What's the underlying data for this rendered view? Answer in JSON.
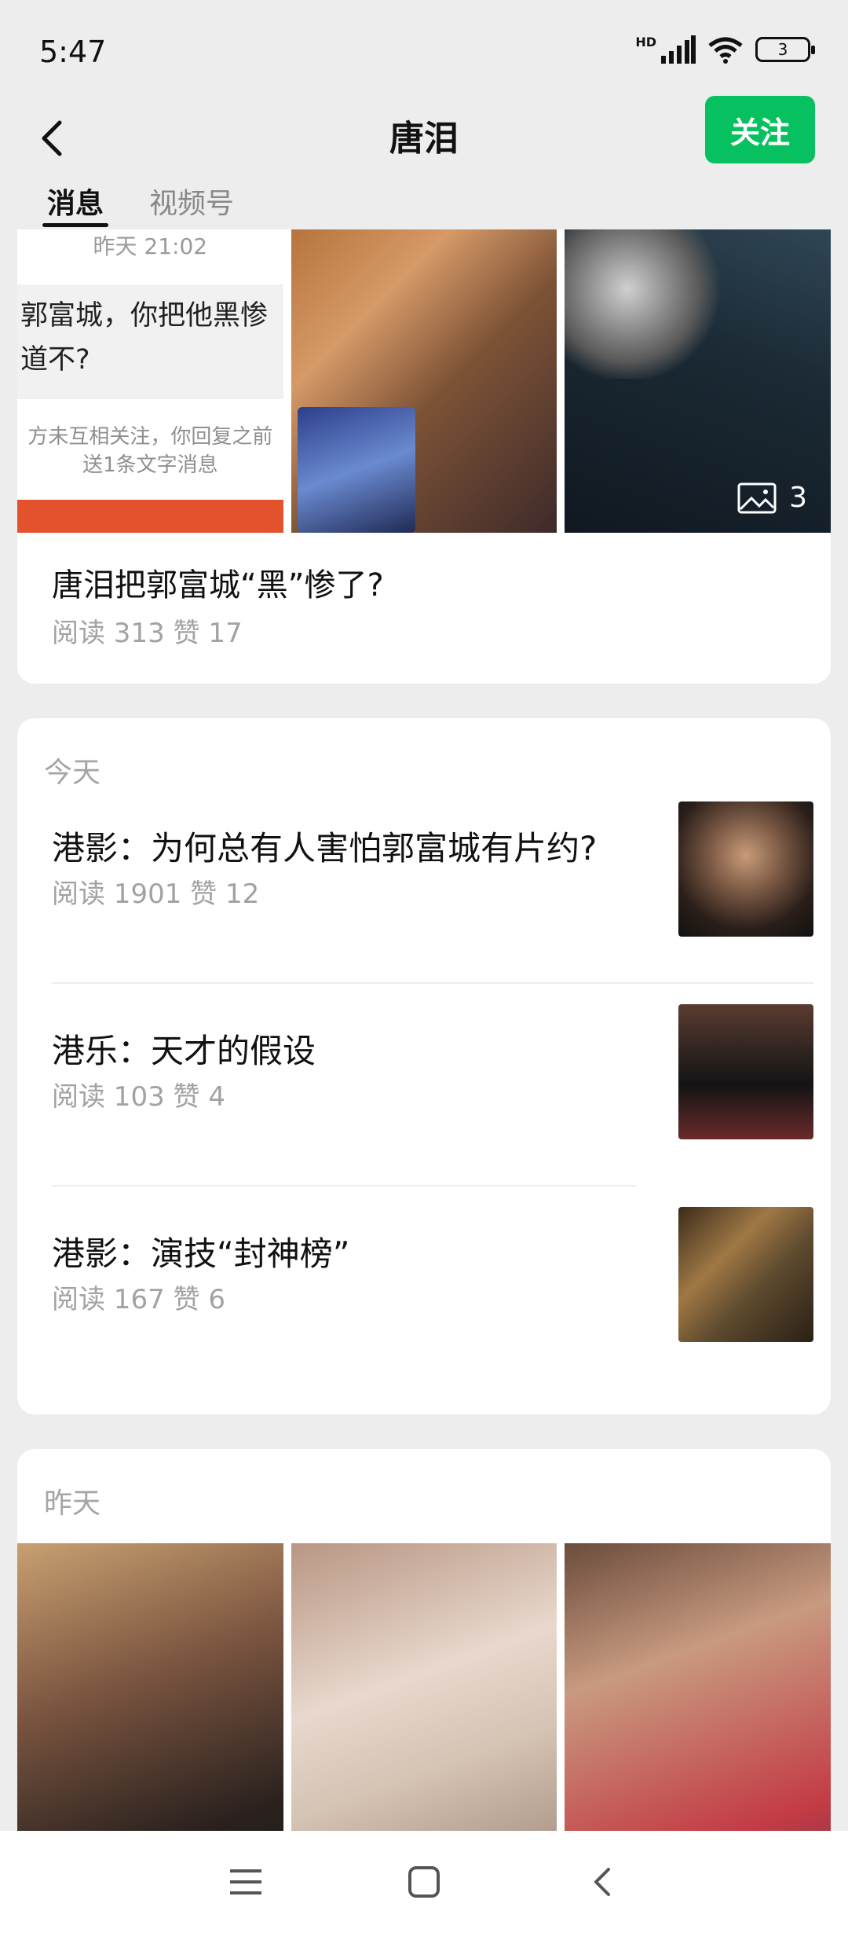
{
  "status_bar": {
    "time": "5:47",
    "battery": "3",
    "signal_label": "HD"
  },
  "header": {
    "title": "唐泪",
    "follow_label": "关注"
  },
  "tabs": [
    {
      "label": "消息",
      "active": true
    },
    {
      "label": "视频号",
      "active": false
    }
  ],
  "featured": {
    "chat_timestamp": "昨天 21:02",
    "chat_text_line1": "郭富城，你把他黑惨",
    "chat_text_line2": "道不?",
    "chat_note_line1": "方未互相关注，你回复之前",
    "chat_note_line2": "送1条文字消息",
    "image_count": "3",
    "title": "唐泪把郭富城“黑”惨了?",
    "meta": "阅读 313   赞 17"
  },
  "today": {
    "label": "今天",
    "items": [
      {
        "title": "港影：为何总有人害怕郭富城有片约?",
        "meta": "阅读 1901   赞 12"
      },
      {
        "title": "港乐：天才的假设",
        "meta": "阅读 103   赞 4"
      },
      {
        "title": "港影：演技“封神榜”",
        "meta": "阅读 167   赞 6"
      }
    ]
  },
  "yesterday": {
    "label": "昨天"
  },
  "colors": {
    "accent": "#07c160",
    "background": "#ededed"
  }
}
